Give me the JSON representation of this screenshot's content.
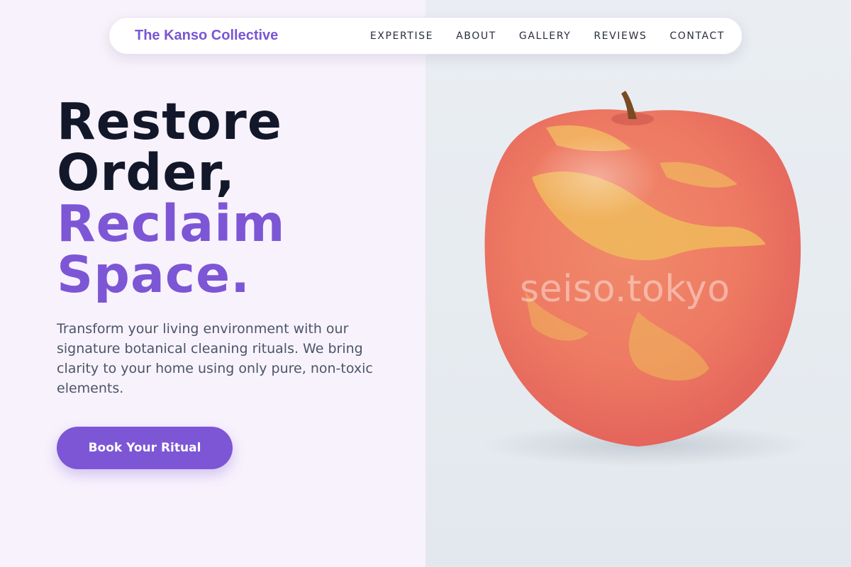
{
  "nav": {
    "brand": "The Kanso Collective",
    "links": [
      "EXPERTISE",
      "ABOUT",
      "GALLERY",
      "REVIEWS",
      "CONTACT"
    ]
  },
  "hero": {
    "title_line1": "Restore",
    "title_line2": "Order,",
    "title_line3": "Reclaim",
    "title_line4": "Space.",
    "description": "Transform your living environment with our signature botanical cleaning rituals. We bring clarity to your home using only pure, non-toxic elements.",
    "cta_label": "Book Your Ritual"
  },
  "image": {
    "watermark": "seiso.tokyo",
    "subject": "apple"
  },
  "colors": {
    "accent": "#7d56d6",
    "heading": "#121829",
    "body_text": "#4a5568",
    "left_background": "#f8f2fc",
    "right_background": "#e8ecf1"
  }
}
